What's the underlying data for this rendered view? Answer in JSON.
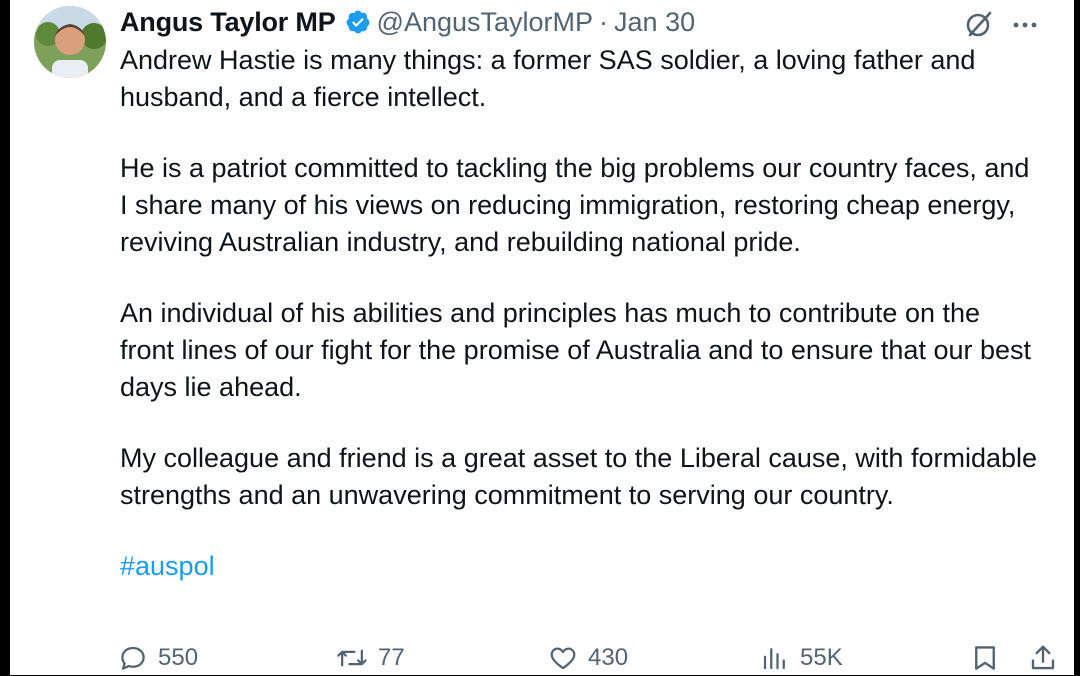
{
  "author": {
    "name": "Angus Taylor MP",
    "handle": "@AngusTaylorMP",
    "separator": "·",
    "date": "Jan 30"
  },
  "body": {
    "paragraphs": [
      "Andrew Hastie is many things: a former SAS soldier, a loving father and husband, and a fierce intellect.",
      "He is a patriot committed to tackling the big problems our country faces, and I share many of his views on reducing immigration, restoring cheap energy, reviving Australian industry, and rebuilding national pride.",
      "An individual of his abilities and principles has much to contribute on the front lines of our fight for the promise of Australia and to ensure that our best days lie ahead.",
      "My colleague and friend is a great asset to the Liberal cause, with formidable strengths and an unwavering commitment to serving our country."
    ],
    "hashtag": "#auspol"
  },
  "stats": {
    "replies": "550",
    "reposts": "77",
    "likes": "430",
    "views": "55K"
  },
  "colors": {
    "text": "#0f1419",
    "secondary": "#536471",
    "link": "#1d9bf0",
    "verified": "#1d9bf0"
  },
  "icons": [
    "verified-badge-icon",
    "grok-icon",
    "more-icon",
    "reply-icon",
    "repost-icon",
    "like-icon",
    "views-icon",
    "bookmark-icon",
    "share-icon"
  ]
}
